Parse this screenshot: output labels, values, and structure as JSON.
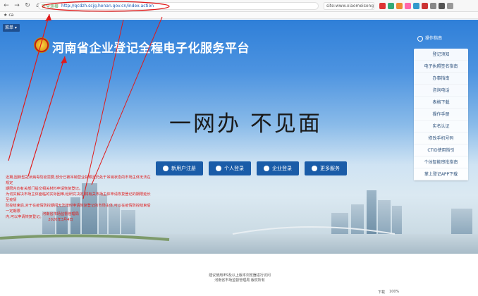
{
  "browser": {
    "secure_label": "安全连接",
    "url": "http://qcdzh.scjg.henan.gov.cn/index.action",
    "search_text": "site:www.xiaomeisong.cn",
    "bookmark": "ca",
    "zoom": "100%",
    "status_items": [
      "下载"
    ]
  },
  "page": {
    "menu_label": "菜单",
    "site_title": "河南省企业登记全程电子化服务平台",
    "slogan": "一网办  不见面",
    "actions": [
      {
        "label": "新用户注册"
      },
      {
        "label": "个人登录"
      },
      {
        "label": "企业登录"
      },
      {
        "label": "更多服务"
      }
    ],
    "guide_title": "操作指南",
    "guide_items": [
      "登记须知",
      "电子执照签名指南",
      "办事指南",
      "咨询电话",
      "表格下载",
      "操作手册",
      "实名认证",
      "修改手机号码",
      "CTID使用指引",
      "个体智能审批指南",
      "掌上登记APP下载"
    ],
    "footer_lines": [
      "建议使用IE9及以上版本浏览器进行访问",
      "河南省市场监督管理局 版权所有"
    ]
  },
  "annotation": {
    "lines": [
      "近期,因新型冠状病毒防疫需要,部分已被吊销营业执照且仍处于吊销状态的市场主体无法在规定",
      "期限内向有关部门提交相关材料申请恢复登记。",
      "为切实解决市场主体面临的实际困难,经研究决定,将有关市场主体申请恢复登记的期限延长至疫情",
      "防控结束后,对于在疫情防控期间无法按时申请恢复登记的市场主体,可以在疫情防控结束后一定期限",
      "内,可以申请恢复登记。"
    ],
    "sign_org": "河南省市场监督管理局",
    "sign_date": "2020年3月4日",
    "color": "#e01a1a"
  }
}
